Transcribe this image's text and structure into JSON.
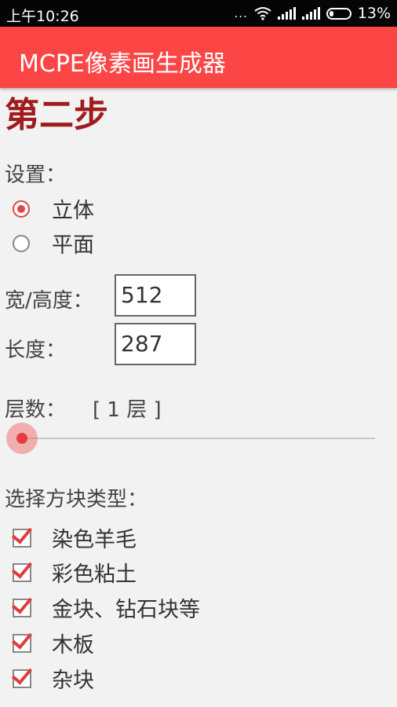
{
  "status": {
    "time": "上午10:26",
    "dots": "...",
    "battery": "13%"
  },
  "app": {
    "title": "MCPE像素画生成器"
  },
  "page": {
    "title": "第二步"
  },
  "settings": {
    "label": "设置：",
    "options": [
      {
        "label": "立体",
        "checked": true
      },
      {
        "label": "平面",
        "checked": false
      }
    ]
  },
  "dimensions": {
    "width_label": "宽/高度：",
    "width_value": "512",
    "length_label": "长度：",
    "length_value": "287"
  },
  "layers": {
    "label": "层数：",
    "value_label": "[ 1 层 ]",
    "slider_fraction": 0
  },
  "blocks": {
    "label": "选择方块类型：",
    "items": [
      {
        "label": "染色羊毛",
        "checked": true
      },
      {
        "label": "彩色粘土",
        "checked": true
      },
      {
        "label": "金块、钻石块等",
        "checked": true
      },
      {
        "label": "木板",
        "checked": true
      },
      {
        "label": "杂块",
        "checked": true
      }
    ]
  },
  "colors": {
    "accent": "#fc4646",
    "title": "#a01c1c"
  }
}
